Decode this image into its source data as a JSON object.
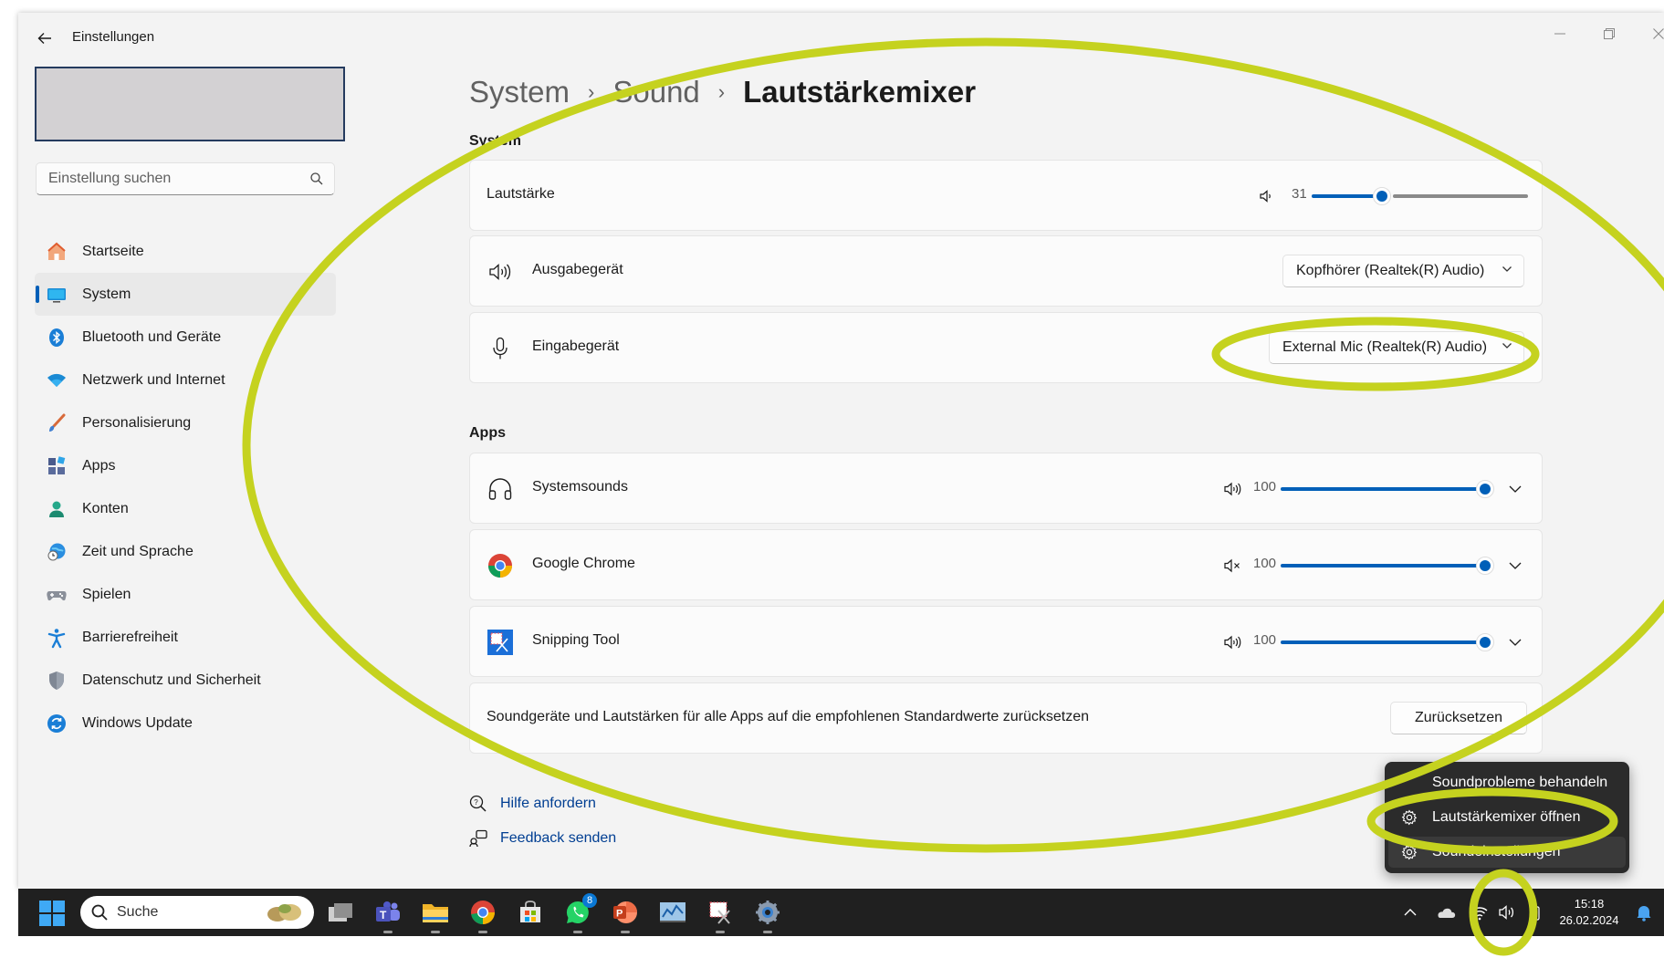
{
  "window": {
    "app_title": "Einstellungen",
    "search_placeholder": "Einstellung suchen"
  },
  "nav": {
    "items": [
      {
        "label": "Startseite",
        "icon": "home-icon"
      },
      {
        "label": "System",
        "icon": "monitor-icon",
        "active": true
      },
      {
        "label": "Bluetooth und Geräte",
        "icon": "bluetooth-icon"
      },
      {
        "label": "Netzwerk und Internet",
        "icon": "wifi-icon"
      },
      {
        "label": "Personalisierung",
        "icon": "brush-icon"
      },
      {
        "label": "Apps",
        "icon": "apps-icon"
      },
      {
        "label": "Konten",
        "icon": "account-icon"
      },
      {
        "label": "Zeit und Sprache",
        "icon": "globe-clock-icon"
      },
      {
        "label": "Spielen",
        "icon": "gamepad-icon"
      },
      {
        "label": "Barrierefreiheit",
        "icon": "accessibility-icon"
      },
      {
        "label": "Datenschutz und Sicherheit",
        "icon": "shield-icon"
      },
      {
        "label": "Windows Update",
        "icon": "update-icon"
      }
    ]
  },
  "breadcrumb": {
    "parts": [
      "System",
      "Sound"
    ],
    "current": "Lautstärkemixer"
  },
  "system_section": {
    "title": "System",
    "volume": {
      "label": "Lautstärke",
      "value": "31",
      "level": 0.31
    },
    "output": {
      "label": "Ausgabegerät",
      "selected": "Kopfhörer (Realtek(R) Audio)"
    },
    "input": {
      "label": "Eingabegerät",
      "selected": "External Mic (Realtek(R) Audio)"
    }
  },
  "apps_section": {
    "title": "Apps",
    "apps": [
      {
        "name": "Systemsounds",
        "volume": "100",
        "level": 1.0,
        "muted": false,
        "icon": "headphones-icon"
      },
      {
        "name": "Google Chrome",
        "volume": "100",
        "level": 1.0,
        "muted": true,
        "icon": "chrome-icon"
      },
      {
        "name": "Snipping Tool",
        "volume": "100",
        "level": 1.0,
        "muted": false,
        "icon": "snipping-tool-icon"
      }
    ]
  },
  "reset": {
    "text": "Soundgeräte und Lautstärken für alle Apps auf die empfohlenen Standardwerte zurücksetzen",
    "button": "Zurücksetzen"
  },
  "links": {
    "help": "Hilfe anfordern",
    "feedback": "Feedback senden"
  },
  "context_menu": {
    "items": [
      "Soundprobleme behandeln",
      "Lautstärkemixer öffnen",
      "Soundeinstellungen"
    ]
  },
  "taskbar": {
    "search_label": "Suche",
    "whatsapp_badge": "8",
    "time": "15:18",
    "date": "26.02.2024"
  },
  "colors": {
    "accent": "#005fb8",
    "highlight": "#c5d21f",
    "link": "#003e92"
  }
}
